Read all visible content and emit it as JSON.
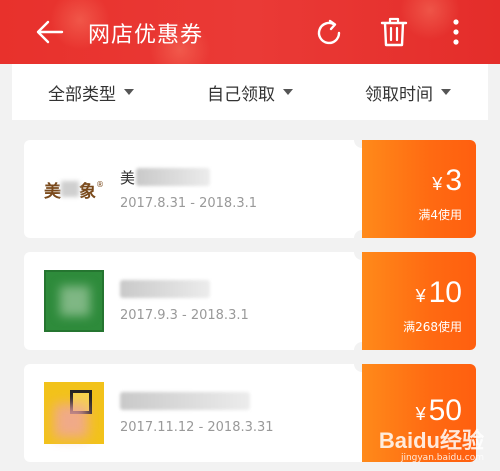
{
  "header": {
    "title": "网店优惠券",
    "icons": {
      "back": "back-arrow-icon",
      "refresh": "refresh-icon",
      "delete": "trash-icon",
      "more": "more-vertical-icon"
    }
  },
  "filters": [
    {
      "label": "全部类型"
    },
    {
      "label": "自己领取"
    },
    {
      "label": "领取时间"
    }
  ],
  "coupons": [
    {
      "logo_text_left": "美",
      "logo_text_right": "象",
      "logo_mark": "®",
      "name_visible": "美",
      "date_range": "2017.8.31 - 2018.3.1",
      "currency": "¥",
      "amount": "3",
      "condition": "满4使用"
    },
    {
      "date_range": "2017.9.3 - 2018.3.1",
      "currency": "¥",
      "amount": "10",
      "condition": "满268使用"
    },
    {
      "date_range": "2017.11.12 - 2018.3.31",
      "currency": "¥",
      "amount": "50"
    }
  ],
  "watermark": {
    "main": "Baidu经验",
    "sub": "jingyan.baidu.com"
  },
  "colors": {
    "header": "#e8312c",
    "coupon_accent": "#ff6a12",
    "background": "#f2f2f2"
  }
}
